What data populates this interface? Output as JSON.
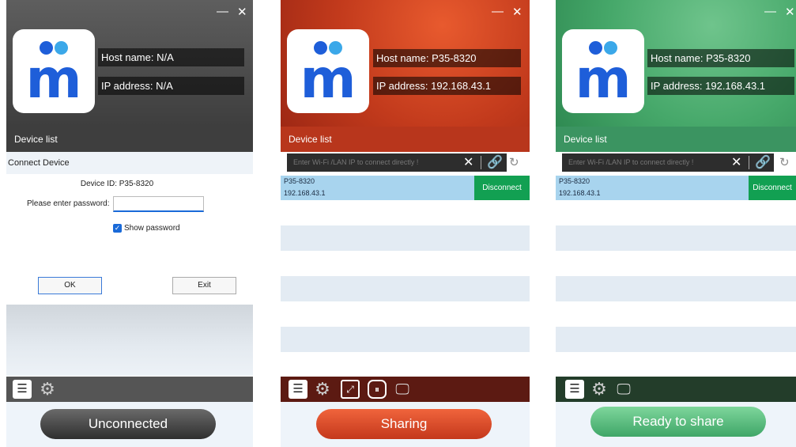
{
  "panels": [
    {
      "theme": "gray",
      "host_name": "Host name:  N/A",
      "ip_address": "IP address:  N/A",
      "device_list_label": "Device list",
      "dialog": {
        "title": "Connect Device",
        "device_id": "Device ID: P35-8320",
        "password_label": "Please enter password:",
        "password_value": "",
        "show_password_label": "Show password",
        "show_password_checked": true,
        "ok_label": "OK",
        "exit_label": "Exit"
      },
      "status": "Unconnected"
    },
    {
      "theme": "red",
      "host_name": "Host name: P35-8320",
      "ip_address": "IP address: 192.168.43.1",
      "device_list_label": "Device list",
      "search_placeholder": "Enter Wi-Fi /LAN IP to connect directly !",
      "device": {
        "name": "P35-8320",
        "ip": "192.168.43.1"
      },
      "disconnect_label": "Disconnect",
      "status": "Sharing"
    },
    {
      "theme": "green",
      "host_name": "Host name: P35-8320",
      "ip_address": "IP address: 192.168.43.1",
      "device_list_label": "Device list",
      "search_placeholder": "Enter Wi-Fi /LAN IP to connect directly !",
      "device": {
        "name": "P35-8320",
        "ip": "192.168.43.1"
      },
      "disconnect_label": "Disconnect",
      "status": "Ready to share"
    }
  ],
  "icons": {
    "minimize": "—",
    "close": "✕",
    "clear": "✕",
    "link": "🔗",
    "refresh": "↻",
    "list": "☰",
    "settings": "⚙",
    "resize": "⤢",
    "pause": "⏸",
    "screen": "🖵",
    "check": "✓",
    "logo_letter": "m"
  },
  "colors": {
    "gray_header": "#4a4a4a",
    "red_header": "#c8401f",
    "green_header": "#46a86a",
    "disconnect": "#12a052",
    "device_row": "#a8d4ee",
    "logo_blue": "#1e5ed9",
    "logo_light_blue": "#3ba8e9"
  }
}
